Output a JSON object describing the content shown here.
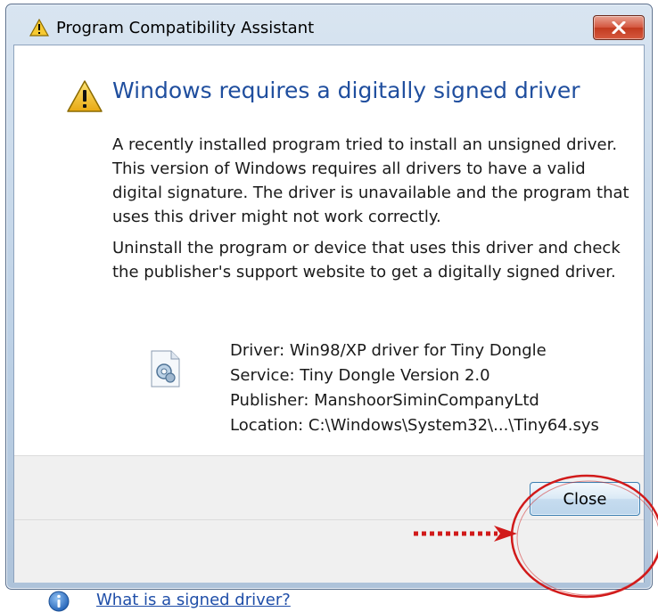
{
  "window": {
    "title": "Program Compatibility Assistant",
    "close_label": "×"
  },
  "content": {
    "headline": "Windows requires a digitally signed driver",
    "paragraph1": "A recently installed program tried to install an unsigned driver. This version of Windows requires all drivers to have a valid digital signature. The driver is unavailable and the program that uses this driver might not work correctly.",
    "paragraph2": "Uninstall the program or device that uses this driver and check the publisher's support website to get a digitally signed driver.",
    "details": [
      "Driver: Win98/XP driver for Tiny Dongle",
      "Service: Tiny Dongle Version 2.0",
      "Publisher: ManshoorSiminCompanyLtd",
      "Location: C:\\Windows\\System32\\...\\Tiny64.sys"
    ]
  },
  "buttons": {
    "close_label": "Close"
  },
  "footer": {
    "help_link": "What is a signed driver?"
  },
  "colors": {
    "headline": "#1f4e9e",
    "link": "#1f4ea8",
    "annotation": "#d11a1a"
  },
  "icons": {
    "title": "warning-icon",
    "main": "warning-icon",
    "file": "driver-file-icon",
    "footer": "info-icon"
  }
}
